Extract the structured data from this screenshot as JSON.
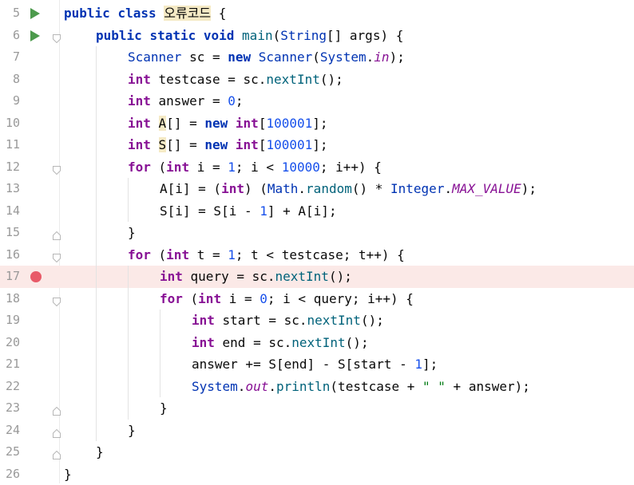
{
  "editor": {
    "lines": [
      {
        "num": "5",
        "indent": 0,
        "marker": "run",
        "fold": "",
        "tokens": [
          [
            "kwb",
            "public"
          ],
          [
            "t",
            " "
          ],
          [
            "kwb",
            "class"
          ],
          [
            "t",
            " "
          ],
          [
            "hl",
            "오류코드"
          ],
          [
            "t",
            " {"
          ]
        ]
      },
      {
        "num": "6",
        "indent": 1,
        "marker": "run",
        "fold": "open",
        "tokens": [
          [
            "kwb",
            "public"
          ],
          [
            "t",
            " "
          ],
          [
            "kwb",
            "static"
          ],
          [
            "t",
            " "
          ],
          [
            "kwb",
            "void"
          ],
          [
            "t",
            " "
          ],
          [
            "fn",
            "main"
          ],
          [
            "t",
            "("
          ],
          [
            "ty",
            "String"
          ],
          [
            "t",
            "[] args) {"
          ]
        ]
      },
      {
        "num": "7",
        "indent": 2,
        "marker": "",
        "fold": "",
        "tokens": [
          [
            "ty",
            "Scanner"
          ],
          [
            "t",
            " sc = "
          ],
          [
            "kwb",
            "new"
          ],
          [
            "t",
            " "
          ],
          [
            "ty",
            "Scanner"
          ],
          [
            "t",
            "("
          ],
          [
            "ty",
            "System"
          ],
          [
            "t",
            "."
          ],
          [
            "st",
            "in"
          ],
          [
            "t",
            ");"
          ]
        ]
      },
      {
        "num": "8",
        "indent": 2,
        "marker": "",
        "fold": "",
        "tokens": [
          [
            "kwp",
            "int"
          ],
          [
            "t",
            " testcase = sc."
          ],
          [
            "fn",
            "nextInt"
          ],
          [
            "t",
            "();"
          ]
        ]
      },
      {
        "num": "9",
        "indent": 2,
        "marker": "",
        "fold": "",
        "tokens": [
          [
            "kwp",
            "int"
          ],
          [
            "t",
            " answer = "
          ],
          [
            "num",
            "0"
          ],
          [
            "t",
            ";"
          ]
        ]
      },
      {
        "num": "10",
        "indent": 2,
        "marker": "",
        "fold": "",
        "tokens": [
          [
            "kwp",
            "int"
          ],
          [
            "t",
            " "
          ],
          [
            "hl",
            "A"
          ],
          [
            "t",
            "[] = "
          ],
          [
            "kwb",
            "new"
          ],
          [
            "t",
            " "
          ],
          [
            "kwp",
            "int"
          ],
          [
            "t",
            "["
          ],
          [
            "num",
            "100001"
          ],
          [
            "t",
            "];"
          ]
        ]
      },
      {
        "num": "11",
        "indent": 2,
        "marker": "",
        "fold": "",
        "tokens": [
          [
            "kwp",
            "int"
          ],
          [
            "t",
            " "
          ],
          [
            "hl",
            "S"
          ],
          [
            "t",
            "[] = "
          ],
          [
            "kwb",
            "new"
          ],
          [
            "t",
            " "
          ],
          [
            "kwp",
            "int"
          ],
          [
            "t",
            "["
          ],
          [
            "num",
            "100001"
          ],
          [
            "t",
            "];"
          ]
        ]
      },
      {
        "num": "12",
        "indent": 2,
        "marker": "",
        "fold": "open",
        "tokens": [
          [
            "kwp",
            "for"
          ],
          [
            "t",
            " ("
          ],
          [
            "kwp",
            "int"
          ],
          [
            "t",
            " i = "
          ],
          [
            "num",
            "1"
          ],
          [
            "t",
            "; i < "
          ],
          [
            "num",
            "10000"
          ],
          [
            "t",
            "; i++) {"
          ]
        ]
      },
      {
        "num": "13",
        "indent": 3,
        "marker": "",
        "fold": "",
        "tokens": [
          [
            "t",
            "A[i] = ("
          ],
          [
            "kwp",
            "int"
          ],
          [
            "t",
            ") ("
          ],
          [
            "ty",
            "Math"
          ],
          [
            "t",
            "."
          ],
          [
            "fn",
            "random"
          ],
          [
            "t",
            "() * "
          ],
          [
            "ty",
            "Integer"
          ],
          [
            "t",
            "."
          ],
          [
            "st",
            "MAX_VALUE"
          ],
          [
            "t",
            ");"
          ]
        ]
      },
      {
        "num": "14",
        "indent": 3,
        "marker": "",
        "fold": "",
        "tokens": [
          [
            "t",
            "S[i] = S[i - "
          ],
          [
            "num",
            "1"
          ],
          [
            "t",
            "] + A[i];"
          ]
        ]
      },
      {
        "num": "15",
        "indent": 2,
        "marker": "",
        "fold": "close",
        "tokens": [
          [
            "t",
            "}"
          ]
        ]
      },
      {
        "num": "16",
        "indent": 2,
        "marker": "",
        "fold": "open",
        "tokens": [
          [
            "kwp",
            "for"
          ],
          [
            "t",
            " ("
          ],
          [
            "kwp",
            "int"
          ],
          [
            "t",
            " t = "
          ],
          [
            "num",
            "1"
          ],
          [
            "t",
            "; t < testcase; t++) {"
          ]
        ]
      },
      {
        "num": "17",
        "indent": 3,
        "marker": "breakpoint",
        "fold": "",
        "tokens": [
          [
            "kwp",
            "int"
          ],
          [
            "t",
            " query = sc."
          ],
          [
            "fn",
            "nextInt"
          ],
          [
            "t",
            "();"
          ]
        ]
      },
      {
        "num": "18",
        "indent": 3,
        "marker": "",
        "fold": "open",
        "tokens": [
          [
            "kwp",
            "for"
          ],
          [
            "t",
            " ("
          ],
          [
            "kwp",
            "int"
          ],
          [
            "t",
            " i = "
          ],
          [
            "num",
            "0"
          ],
          [
            "t",
            "; i < query; i++) {"
          ]
        ]
      },
      {
        "num": "19",
        "indent": 4,
        "marker": "",
        "fold": "",
        "tokens": [
          [
            "kwp",
            "int"
          ],
          [
            "t",
            " start = sc."
          ],
          [
            "fn",
            "nextInt"
          ],
          [
            "t",
            "();"
          ]
        ]
      },
      {
        "num": "20",
        "indent": 4,
        "marker": "",
        "fold": "",
        "tokens": [
          [
            "kwp",
            "int"
          ],
          [
            "t",
            " end = sc."
          ],
          [
            "fn",
            "nextInt"
          ],
          [
            "t",
            "();"
          ]
        ]
      },
      {
        "num": "21",
        "indent": 4,
        "marker": "",
        "fold": "",
        "tokens": [
          [
            "t",
            "answer += S[end] - S[start - "
          ],
          [
            "num",
            "1"
          ],
          [
            "t",
            "];"
          ]
        ]
      },
      {
        "num": "22",
        "indent": 4,
        "marker": "",
        "fold": "",
        "tokens": [
          [
            "ty",
            "System"
          ],
          [
            "t",
            "."
          ],
          [
            "st",
            "out"
          ],
          [
            "t",
            "."
          ],
          [
            "fn",
            "println"
          ],
          [
            "t",
            "(testcase + "
          ],
          [
            "str",
            "\" \""
          ],
          [
            "t",
            " + answer);"
          ]
        ]
      },
      {
        "num": "23",
        "indent": 3,
        "marker": "",
        "fold": "close",
        "tokens": [
          [
            "t",
            "}"
          ]
        ]
      },
      {
        "num": "24",
        "indent": 2,
        "marker": "",
        "fold": "close",
        "tokens": [
          [
            "t",
            "}"
          ]
        ]
      },
      {
        "num": "25",
        "indent": 1,
        "marker": "",
        "fold": "close",
        "tokens": [
          [
            "t",
            "}"
          ]
        ]
      },
      {
        "num": "26",
        "indent": 0,
        "marker": "",
        "fold": "",
        "tokens": [
          [
            "t",
            "}"
          ]
        ]
      }
    ]
  },
  "colors": {
    "keyword": "#0033b3",
    "keyword_purple": "#871094",
    "number": "#1750eb",
    "method": "#00627a",
    "string": "#067d17",
    "breakpoint": "#e85a68",
    "breakpoint_line": "#fbe9e7",
    "run_icon": "#4c9a4c",
    "highlight": "#f5eac5",
    "line_number": "#999999"
  }
}
